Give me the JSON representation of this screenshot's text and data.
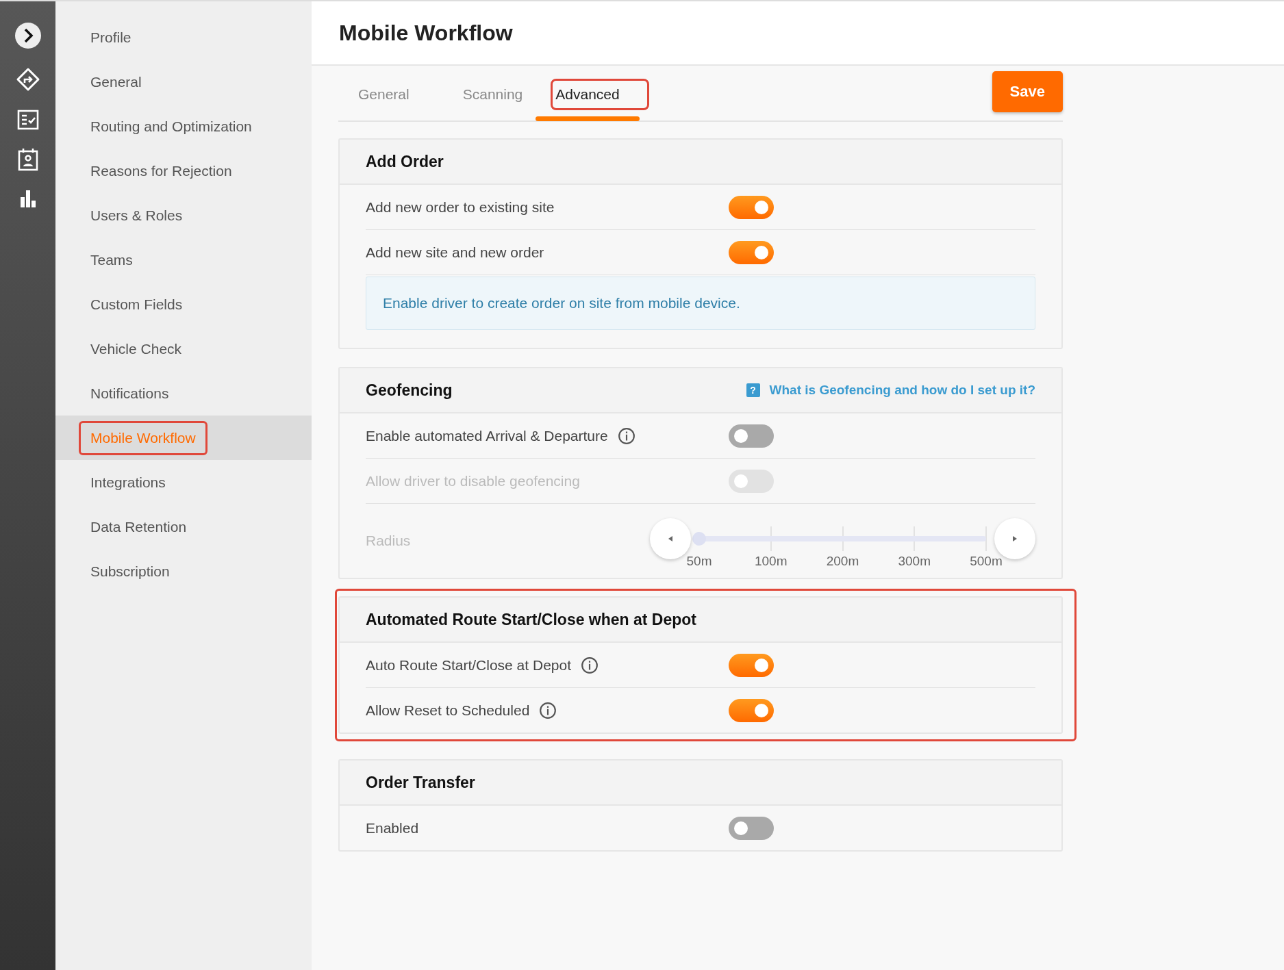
{
  "nav": {
    "items": [
      {
        "label": "Profile",
        "selected": false,
        "highlighted": false
      },
      {
        "label": "General",
        "selected": false,
        "highlighted": false
      },
      {
        "label": "Routing and Optimization",
        "selected": false,
        "highlighted": false
      },
      {
        "label": "Reasons for Rejection",
        "selected": false,
        "highlighted": false
      },
      {
        "label": "Users & Roles",
        "selected": false,
        "highlighted": false
      },
      {
        "label": "Teams",
        "selected": false,
        "highlighted": false
      },
      {
        "label": "Custom Fields",
        "selected": false,
        "highlighted": false
      },
      {
        "label": "Vehicle Check",
        "selected": false,
        "highlighted": false
      },
      {
        "label": "Notifications",
        "selected": false,
        "highlighted": false
      },
      {
        "label": "Mobile Workflow",
        "selected": true,
        "highlighted": true
      },
      {
        "label": "Integrations",
        "selected": false,
        "highlighted": false
      },
      {
        "label": "Data Retention",
        "selected": false,
        "highlighted": false
      },
      {
        "label": "Subscription",
        "selected": false,
        "highlighted": false
      }
    ]
  },
  "header": {
    "title": "Mobile Workflow"
  },
  "tabs": [
    {
      "label": "General",
      "selected": false,
      "highlighted": false
    },
    {
      "label": "Scanning",
      "selected": false,
      "highlighted": false
    },
    {
      "label": "Advanced",
      "selected": true,
      "highlighted": true
    }
  ],
  "save_button": "Save",
  "sections": [
    {
      "title": "Add Order",
      "highlighted": false,
      "rows": [
        {
          "kind": "toggle",
          "label": "Add new order to existing site",
          "on": true,
          "disabled": false
        },
        {
          "kind": "toggle",
          "label": "Add new site and new order",
          "on": true,
          "disabled": false
        },
        {
          "kind": "note",
          "text": "Enable driver to create order on site from mobile device."
        }
      ]
    },
    {
      "title": "Geofencing",
      "highlighted": false,
      "help": {
        "badge": "?",
        "link": "What is Geofencing and how do I set up it?"
      },
      "rows": [
        {
          "kind": "toggle_info",
          "label": "Enable automated Arrival & Departure",
          "on": false,
          "disabled": false
        },
        {
          "kind": "toggle",
          "label": "Allow driver to disable geofencing",
          "on": false,
          "disabled": true
        },
        {
          "kind": "slider",
          "label": "Radius",
          "disabled": true,
          "level": 0,
          "ticks": [
            "50m",
            "100m",
            "200m",
            "300m",
            "500m"
          ]
        }
      ]
    },
    {
      "title": "Automated Route Start/Close when at Depot",
      "highlighted": true,
      "rows": [
        {
          "kind": "toggle_info",
          "label": "Auto Route Start/Close at Depot",
          "on": true,
          "disabled": false
        },
        {
          "kind": "toggle_info",
          "label": "Allow Reset to Scheduled",
          "on": true,
          "disabled": false
        }
      ]
    },
    {
      "title": "Order Transfer",
      "highlighted": false,
      "rows": [
        {
          "kind": "toggle",
          "label": "Enabled",
          "on": false,
          "disabled": false
        }
      ]
    }
  ]
}
